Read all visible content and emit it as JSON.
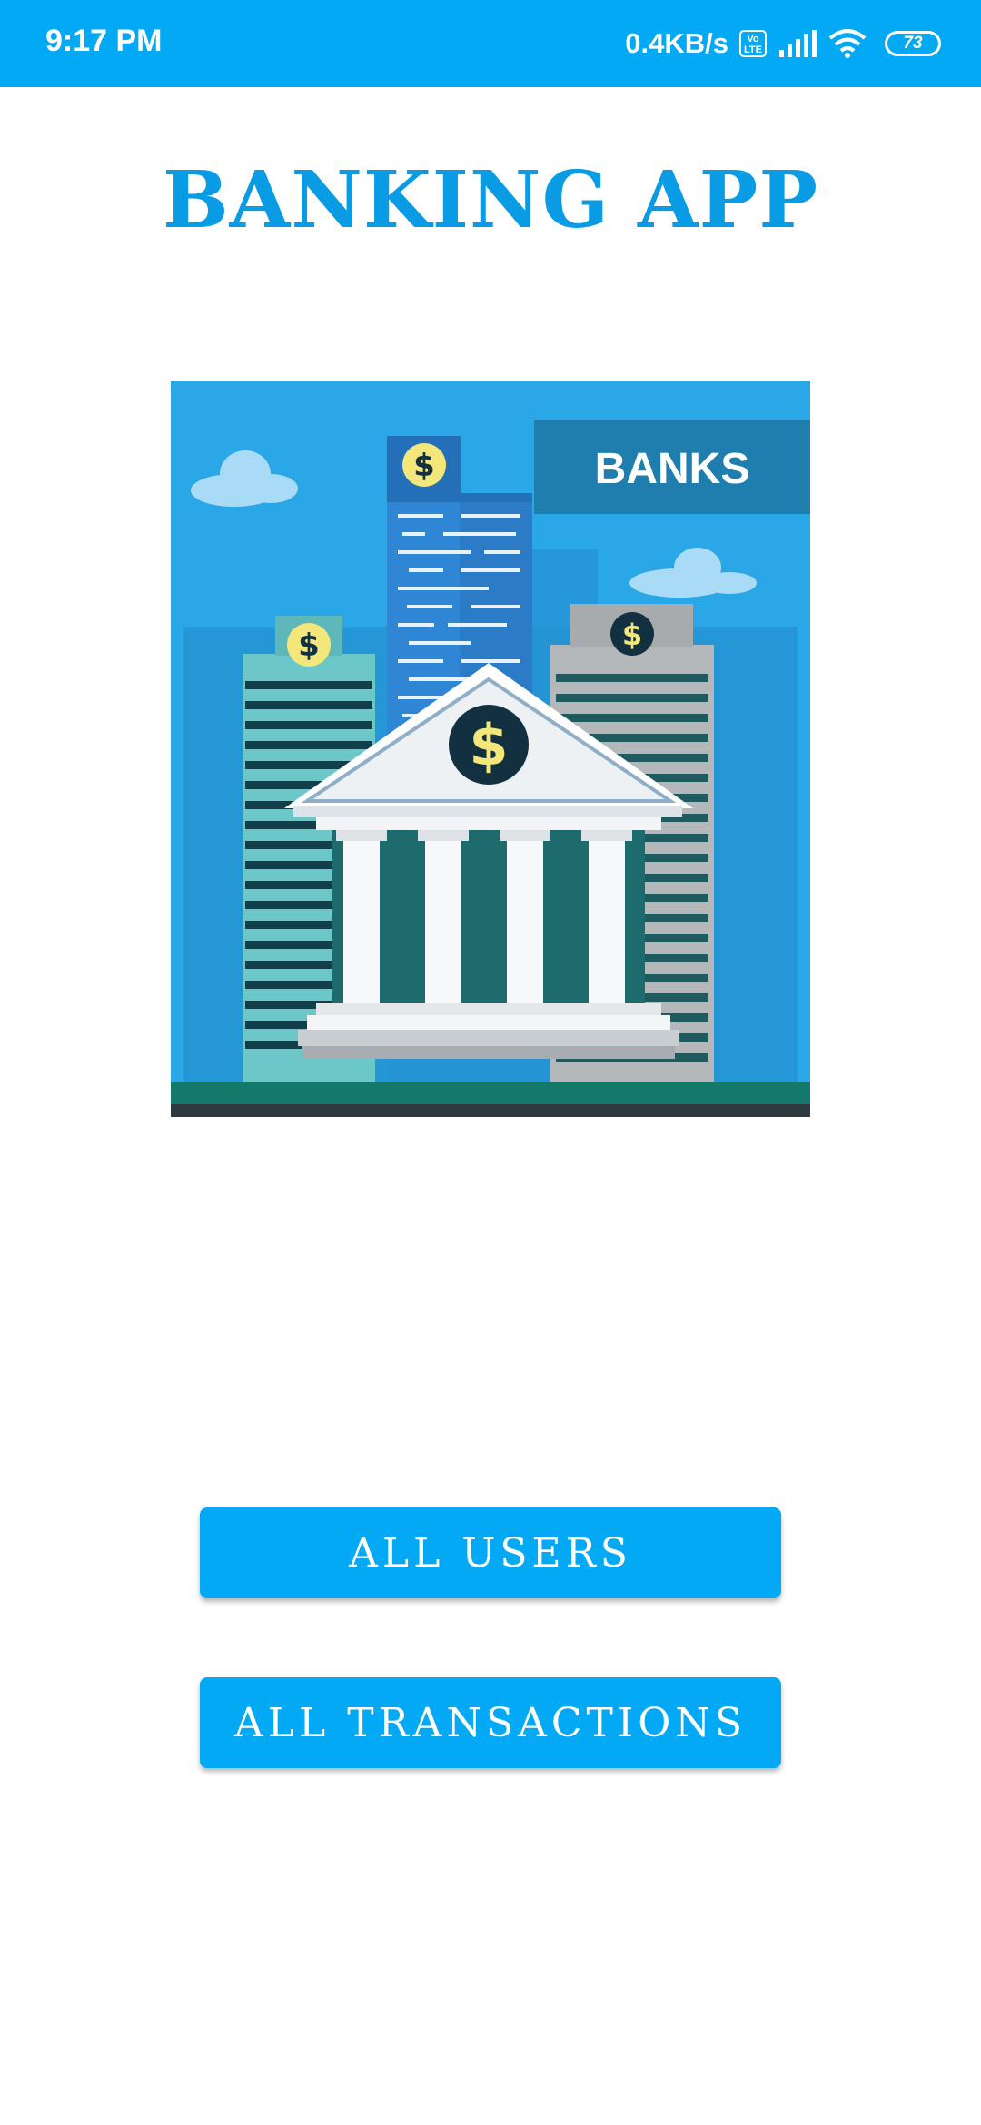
{
  "status_bar": {
    "time": "9:17 PM",
    "net_speed": "0.4KB/s",
    "volte": "Vo\nLTE",
    "battery": "73",
    "icons": [
      "volte-icon",
      "signal-icon",
      "wifi-icon",
      "battery-icon"
    ]
  },
  "app": {
    "title": "BANKING APP"
  },
  "hero": {
    "sign_text": "BANKS",
    "currency_symbol": "$"
  },
  "buttons": {
    "all_users": "ALL USERS",
    "all_transactions": "ALL TRANSACTIONS"
  },
  "colors": {
    "primary": "#03A9F4",
    "title": "#0A9BE5",
    "sky": "#2AA7E6",
    "column_dark": "#1E6B6E",
    "coin": "#F3E67A",
    "coin_bg": "#12303F"
  }
}
